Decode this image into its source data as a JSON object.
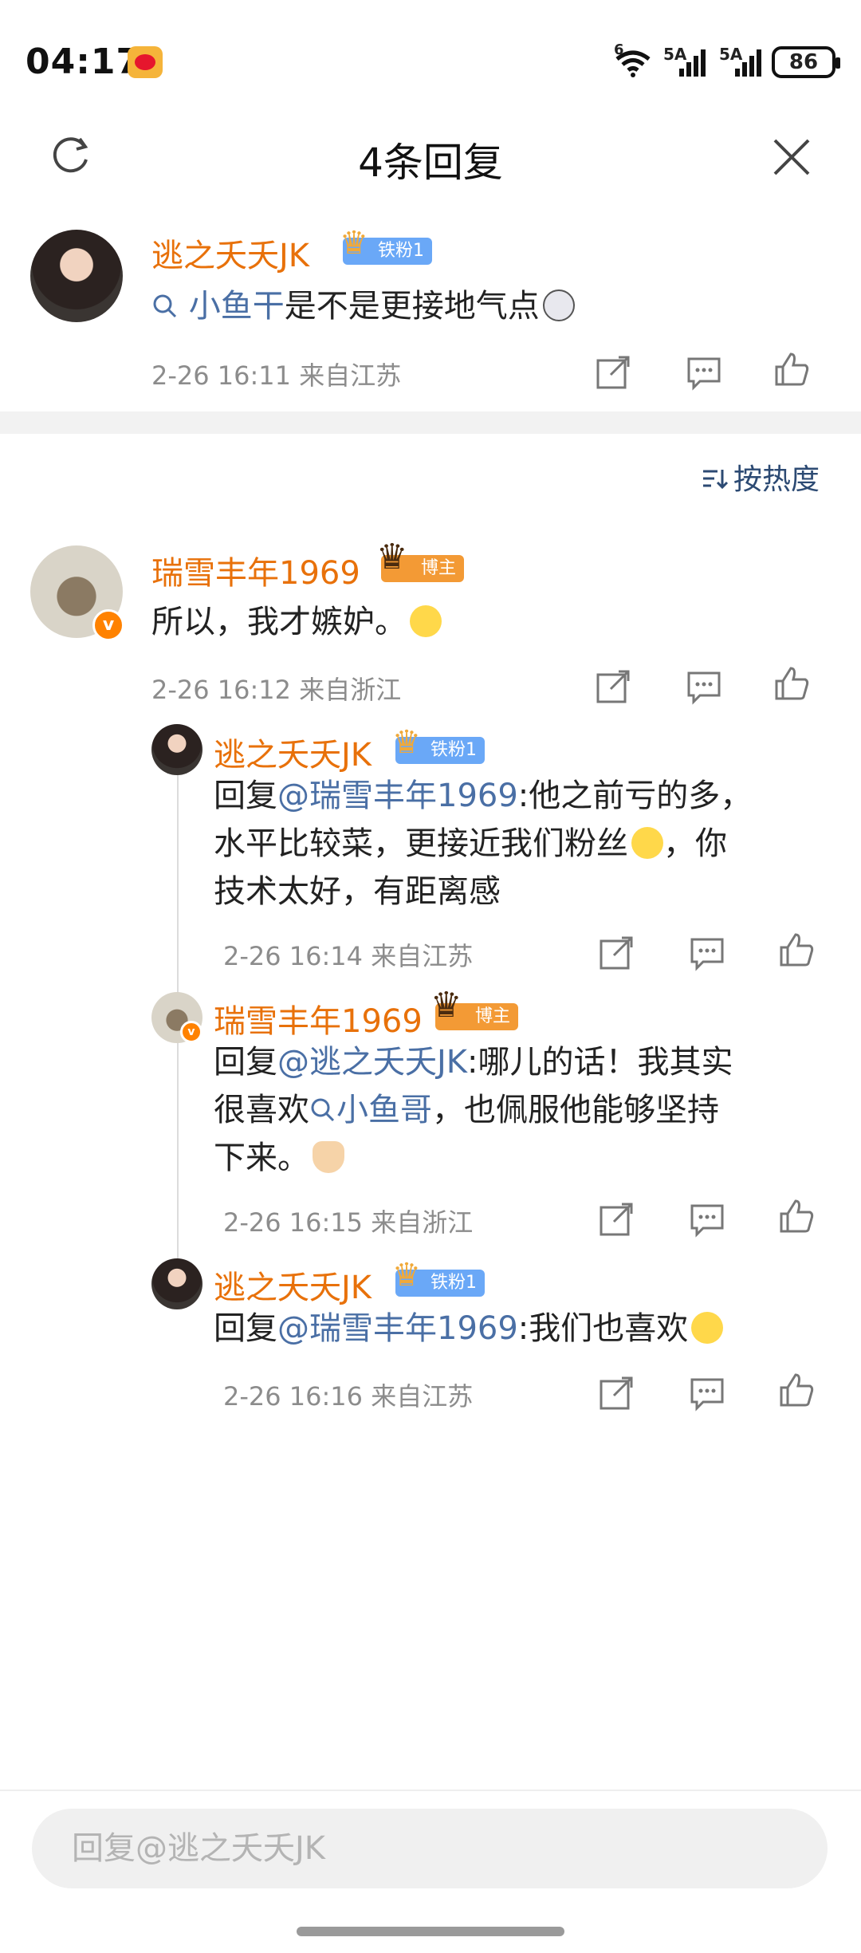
{
  "status_bar": {
    "time": "04:17",
    "battery": "86",
    "signal_1": "5A",
    "signal_2": "5A",
    "wifi": "6"
  },
  "header": {
    "title": "4条回复"
  },
  "main_comment": {
    "username": "逃之夭夭JK",
    "badge": "铁粉1",
    "topic": "小鱼干",
    "text": "是不是更接地气点",
    "meta": "2-26 16:11 来自江苏"
  },
  "sort": {
    "label": "按热度"
  },
  "replies": [
    {
      "username": "瑞雪丰年1969",
      "badge": "博主",
      "text": "所以，我才嫉妒。",
      "meta": "2-26 16:12 来自浙江"
    },
    {
      "username": "逃之夭夭JK",
      "badge": "铁粉1",
      "prefix": "回复",
      "mention": "@瑞雪丰年1969",
      "text_1": ":他之前亏的多，",
      "text_2": "水平比较菜，更接近我们粉丝",
      "text_2b": "，你",
      "text_3": "技术太好，有距离感",
      "meta": "2-26 16:14 来自江苏"
    },
    {
      "username": "瑞雪丰年1969",
      "badge": "博主",
      "prefix": "回复",
      "mention": "@逃之夭夭JK",
      "text_1": ":哪儿的话！我其实",
      "text_2a": "很喜欢",
      "topic": "小鱼哥",
      "text_2b": "，也佩服他能够坚持",
      "text_3": "下来。",
      "meta": "2-26 16:15 来自浙江"
    },
    {
      "username": "逃之夭夭JK",
      "badge": "铁粉1",
      "prefix": "回复",
      "mention": "@瑞雪丰年1969",
      "text_1": ":我们也喜欢",
      "meta": "2-26 16:16 来自江苏"
    }
  ],
  "composer": {
    "placeholder": "回复@逃之夭夭JK"
  },
  "colors": {
    "username": "#e8710a",
    "mention": "#4a6fa5",
    "meta": "#8c8c8c",
    "fan_badge": "#6aa8f7",
    "blogger_badge": "#f39a35"
  }
}
